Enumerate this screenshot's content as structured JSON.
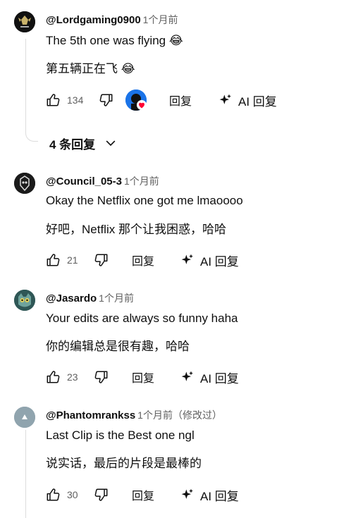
{
  "comments": [
    {
      "author": "@Lordgaming0900",
      "time": "1个月前",
      "text": "The 5th one was flying 😂",
      "translation": "第五辆正在飞 😂",
      "likes": "134",
      "reply_label": "回复",
      "ai_reply_label": "AI 回复"
    },
    {
      "author": "@Council_05-3",
      "time": "1个月前",
      "text": "Okay the Netflix one got me lmaoooo",
      "translation": "好吧，Netflix 那个让我困惑，哈哈",
      "likes": "21",
      "reply_label": "回复",
      "ai_reply_label": "AI 回复"
    },
    {
      "author": "@Jasardo",
      "time": "1个月前",
      "text": "Your edits are always so funny haha",
      "translation": "你的编辑总是很有趣，哈哈",
      "likes": "23",
      "reply_label": "回复",
      "ai_reply_label": "AI 回复"
    },
    {
      "author": "@Phantomrankss",
      "time": "1个月前（修改过）",
      "text": "Last Clip is the Best one ngl",
      "translation": "说实话，最后的片段是最棒的",
      "likes": "30",
      "reply_label": "回复",
      "ai_reply_label": "AI 回复"
    }
  ],
  "replies_toggle": {
    "label": "4 条回复"
  },
  "colors": {
    "text": "#0f0f0f",
    "secondary": "#606060",
    "creator_heart": "#ff0033",
    "avatar_placeholder": "#90a4ae"
  },
  "icons": [
    "thumb-up-icon",
    "thumb-down-icon",
    "sparkle-icon",
    "chevron-down-icon",
    "heart-icon"
  ]
}
